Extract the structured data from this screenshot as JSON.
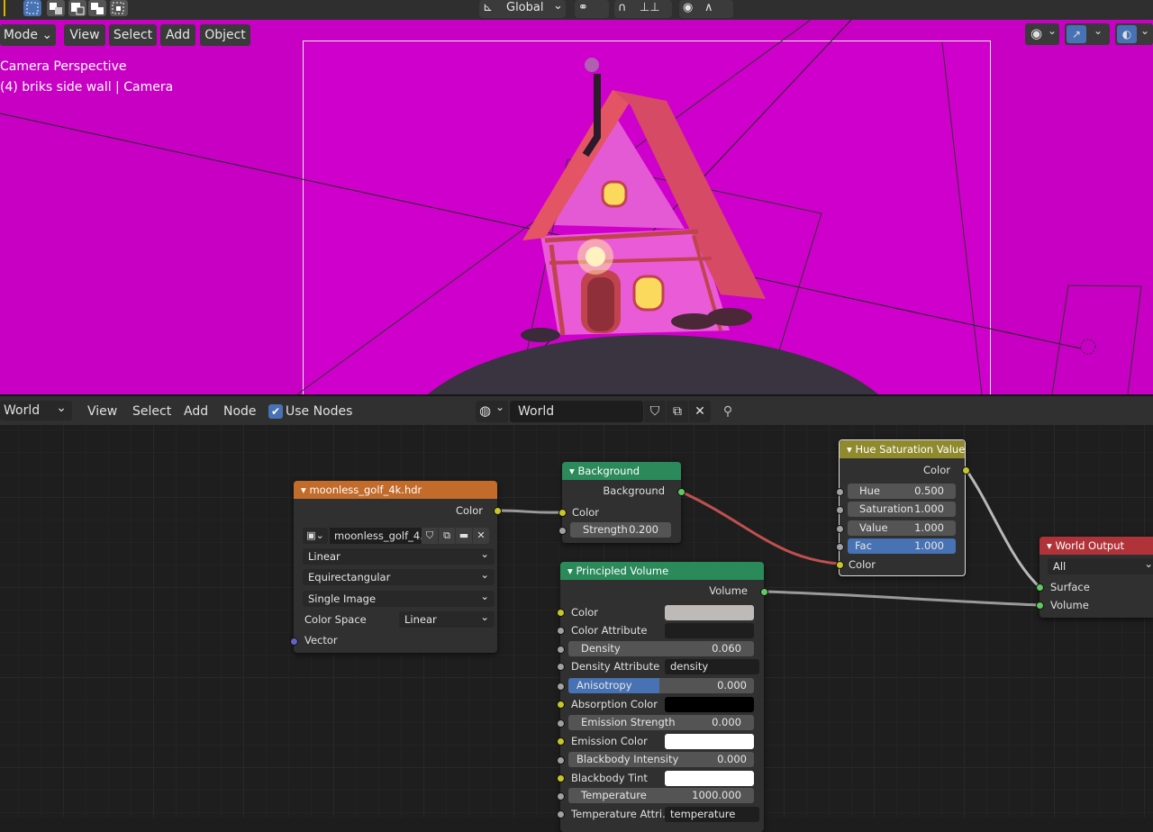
{
  "toolbar_3d": {
    "orientation": "Global"
  },
  "viewport": {
    "menu": [
      "Mode",
      "View",
      "Select",
      "Add",
      "Object"
    ],
    "overlay_line1": "Camera Perspective",
    "overlay_line2": "(4) briks side wall | Camera"
  },
  "node_editor": {
    "editor_type": "World",
    "menu": [
      "View",
      "Select",
      "Add",
      "Node"
    ],
    "use_nodes_label": "Use Nodes",
    "use_nodes_checked": true,
    "datablock_name": "World"
  },
  "nodes": {
    "env_texture": {
      "title": "moonless_golf_4k.hdr",
      "out_color": "Color",
      "image_name": "moonless_golf_4...",
      "interpolation": "Linear",
      "projection": "Equirectangular",
      "source": "Single Image",
      "color_space_label": "Color Space",
      "color_space": "Linear",
      "in_vector": "Vector"
    },
    "background": {
      "title": "Background",
      "out_background": "Background",
      "in_color": "Color",
      "strength_label": "Strength",
      "strength": "0.200"
    },
    "hue_sat": {
      "title": "Hue Saturation Value",
      "out_color": "Color",
      "hue_label": "Hue",
      "hue": "0.500",
      "sat_label": "Saturation",
      "sat": "1.000",
      "val_label": "Value",
      "val": "1.000",
      "fac_label": "Fac",
      "fac": "1.000",
      "in_color": "Color"
    },
    "world_output": {
      "title": "World Output",
      "target": "All",
      "in_surface": "Surface",
      "in_volume": "Volume"
    },
    "principled_volume": {
      "title": "Principled Volume",
      "out_volume": "Volume",
      "color_label": "Color",
      "color_attr_label": "Color Attribute",
      "density_label": "Density",
      "density": "0.060",
      "density_attr_label": "Density Attribute",
      "density_attr": "density",
      "anisotropy_label": "Anisotropy",
      "anisotropy": "0.000",
      "absorption_label": "Absorption Color",
      "emission_strength_label": "Emission Strength",
      "emission_strength": "0.000",
      "emission_color_label": "Emission Color",
      "blackbody_intensity_label": "Blackbody Intensity",
      "blackbody_intensity": "0.000",
      "blackbody_tint_label": "Blackbody Tint",
      "temperature_label": "Temperature",
      "temperature": "1000.000",
      "temperature_attr_label": "Temperature Attri...",
      "temperature_attr": "temperature"
    }
  },
  "colors": {
    "viewport_bg": "#c800c4",
    "texture_header": "#c26b2a",
    "shader_header": "#2b8a5a",
    "converter_header": "#8f8a2e",
    "output_header": "#b0333a",
    "socket_color": "#c7c729",
    "socket_shader": "#63c763",
    "socket_float": "#a1a1a1",
    "socket_vector": "#6363c7",
    "link_red": "#c05050",
    "field_blue": "#4772b3"
  }
}
